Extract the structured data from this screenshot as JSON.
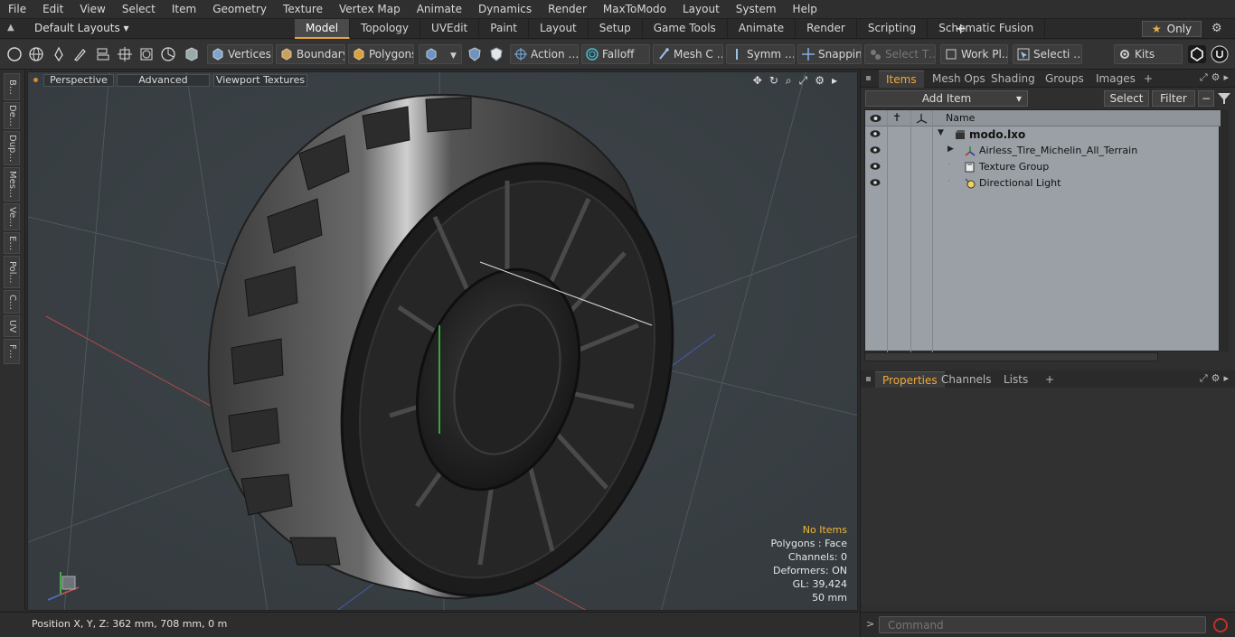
{
  "menu": [
    "File",
    "Edit",
    "View",
    "Select",
    "Item",
    "Geometry",
    "Texture",
    "Vertex Map",
    "Animate",
    "Dynamics",
    "Render",
    "MaxToModo",
    "Layout",
    "System",
    "Help"
  ],
  "layout": {
    "selector": "Default Layouts ▾",
    "tabs": [
      "Model",
      "Topology",
      "UVEdit",
      "Paint",
      "Layout",
      "Setup",
      "Game Tools",
      "Animate",
      "Render",
      "Scripting",
      "Schematic Fusion"
    ],
    "active_tab": "Model",
    "plus": "+",
    "only_label": "Only",
    "only_star": "★",
    "gear": "⚙"
  },
  "toolbar": {
    "vertices": "Vertices",
    "boundary": "Boundary",
    "polygons": "Polygons",
    "action": "Action  …",
    "falloff": "Falloff",
    "mesh_c": "Mesh C …",
    "symm": "Symm …",
    "snapping": "Snapping",
    "select_t": "Select T…",
    "work_pl": "Work Pl…",
    "selecti": "Selecti …",
    "kits": "Kits"
  },
  "left_strip": [
    "B…",
    "De…",
    "Dup…",
    "Mes…",
    "Ve…",
    "E…",
    "Pol…",
    "C…",
    "UV",
    "F…"
  ],
  "viewport": {
    "perspective": "Perspective",
    "advanced": "Advanced",
    "textures": "Viewport Textures",
    "icons": "✥↻⌕⤢⚙▸",
    "info": {
      "no_items": "No Items",
      "polygons": "Polygons : Face",
      "channels": "Channels: 0",
      "deformers": "Deformers: ON",
      "gl": "GL: 39,424",
      "scale": "50 mm"
    }
  },
  "status": {
    "position": "Position X, Y, Z:   362 mm, 708 mm, 0 m"
  },
  "items_panel": {
    "tabs": [
      "Items",
      "Mesh Ops",
      "Shading",
      "Groups",
      "Images"
    ],
    "active_tab": "Items",
    "plus": "+",
    "add_item": "Add Item",
    "add_item_arrow": "▾",
    "select": "Select",
    "filter": "Filter",
    "column_name": "Name",
    "rows": [
      {
        "label": "modo.lxo",
        "bold": true,
        "indent": 0
      },
      {
        "label": "Airless_Tire_Michelin_All_Terrain",
        "bold": false,
        "indent": 1
      },
      {
        "label": "Texture Group",
        "bold": false,
        "indent": 1
      },
      {
        "label": "Directional Light",
        "bold": false,
        "indent": 1
      }
    ]
  },
  "props_panel": {
    "tabs": [
      "Properties",
      "Channels",
      "Lists"
    ],
    "active_tab": "Properties",
    "plus": "+"
  },
  "command": {
    "placeholder": "Command",
    "chevron": ">"
  },
  "colors": {
    "accent": "#e8a33d",
    "viewport_bg": "#3b4145",
    "list_bg": "#9aa0a5",
    "record": "#c2302c"
  }
}
